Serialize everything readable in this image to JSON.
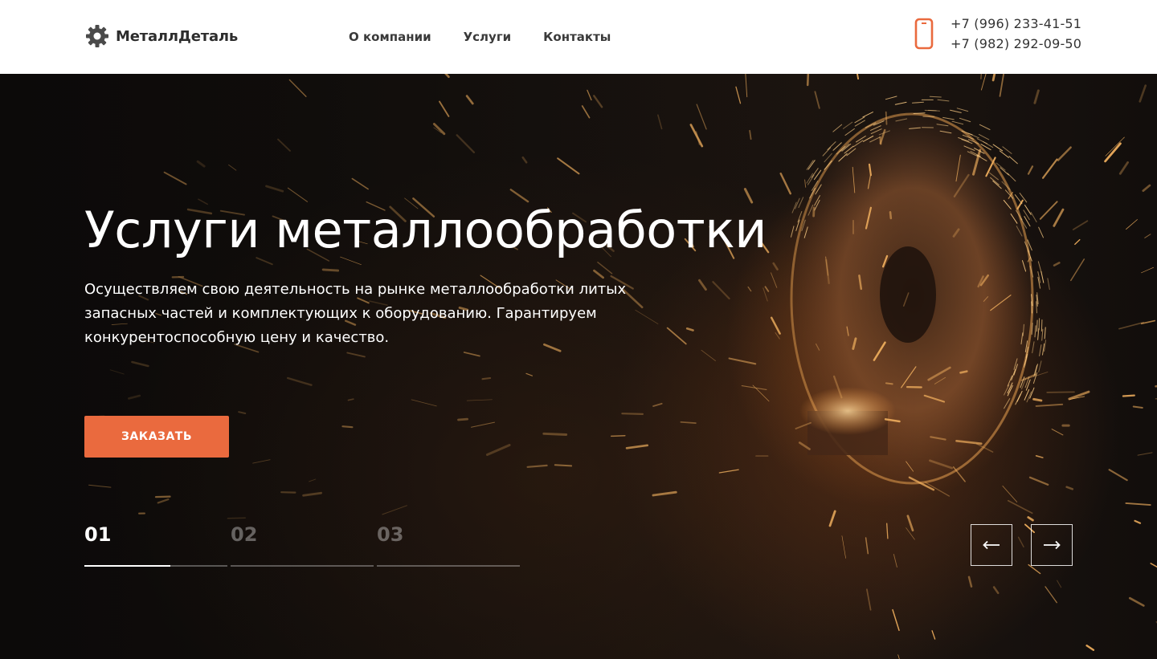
{
  "brand": {
    "name": "МеталлДеталь",
    "icon": "gear-icon"
  },
  "nav": [
    {
      "label": "О компании"
    },
    {
      "label": "Услуги"
    },
    {
      "label": "Контакты"
    }
  ],
  "contacts": {
    "icon": "phone-icon",
    "phone1": "+7 (996) 233-41-51",
    "phone2": "+7 (982) 292-09-50"
  },
  "hero": {
    "title": "Услуги металлообработки",
    "text": "Осуществляем свою деятельность на рынке металлообработки литых запасных частей и комплектующих к оборудованию. Гарантируем конкурентоспособную цену и качество.",
    "button": "ЗАКАЗАТЬ"
  },
  "slider": {
    "slides": [
      {
        "label": "01"
      },
      {
        "label": "02"
      },
      {
        "label": "03"
      }
    ],
    "active": 0,
    "progress": 0.6,
    "prev_icon": "arrow-left-icon",
    "next_icon": "arrow-right-icon"
  },
  "colors": {
    "accent": "#ea6a3e",
    "text": "#2d2d2d",
    "hero_text": "#ffffff"
  }
}
